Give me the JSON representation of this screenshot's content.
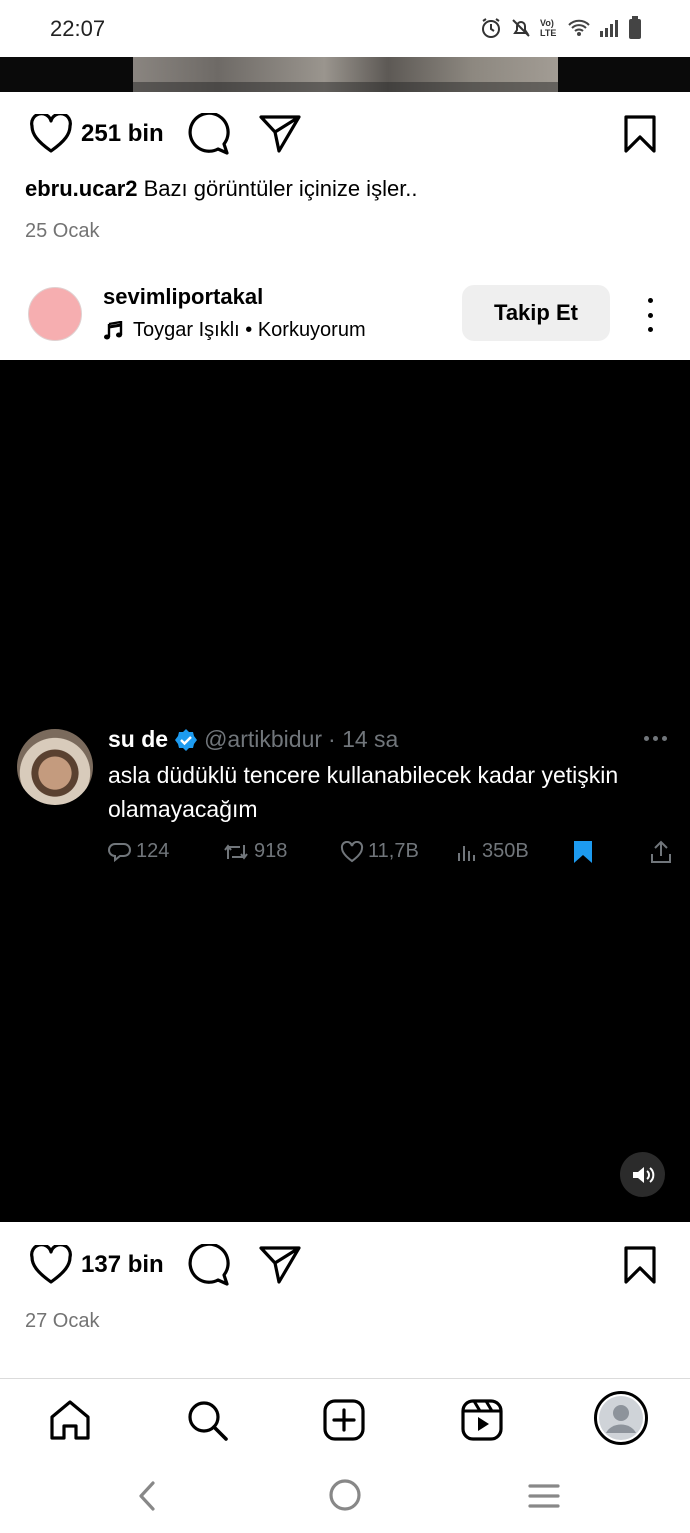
{
  "status_bar": {
    "time": "22:07",
    "icons": [
      "alarm-icon",
      "mute-bell-icon",
      "volte-icon",
      "wifi-icon",
      "signal-icon",
      "battery-icon"
    ],
    "volte_text": "Vo) LTE"
  },
  "post1": {
    "likes": "251 bin",
    "caption_user": "ebru.ucar2",
    "caption_text": "Bazı görüntüler içinize işler..",
    "date": "25 Ocak"
  },
  "post2": {
    "username": "sevimliportakal",
    "music": "Toygar Işıklı • Korkuyorum",
    "follow_label": "Takip Et",
    "tweet": {
      "name": "su de",
      "handle": "@artikbidur",
      "time": "· 14 sa",
      "text": "asla düdüklü tencere kullanabilecek kadar yetişkin olamayacağım",
      "replies": "124",
      "retweets": "918",
      "likes": "11,7B",
      "views": "350B"
    },
    "likes": "137 bin",
    "date": "27 Ocak"
  },
  "bottom_nav": [
    "home-icon",
    "search-icon",
    "create-icon",
    "reels-icon",
    "profile-icon"
  ],
  "system_nav": [
    "back-icon",
    "home-circle-icon",
    "recents-icon"
  ],
  "colors": {
    "accent_blue": "#1d9bf0",
    "muted": "#737373",
    "follow_bg": "#efefef",
    "avatar_pink": "#f6aeb0"
  }
}
